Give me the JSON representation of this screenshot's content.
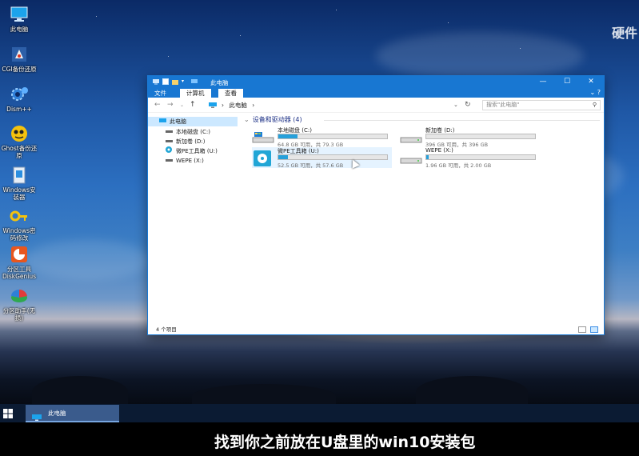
{
  "desktop": {
    "watermark": "硬件",
    "icons": [
      {
        "label": "此电脑",
        "icon": "computer-icon"
      },
      {
        "label": "CGI备份还原",
        "icon": "cgi-backup-icon"
      },
      {
        "label": "Dism++",
        "icon": "dism-gear-icon"
      },
      {
        "label": "Ghost备份还原",
        "icon": "ghost-icon"
      },
      {
        "label": "Windows安装器",
        "icon": "windows-installer-icon"
      },
      {
        "label": "Windows密码修改",
        "icon": "key-icon"
      },
      {
        "label": "分区工具DiskGenius",
        "icon": "diskgenius-icon"
      },
      {
        "label": "分区助手(无损)",
        "icon": "partition-assistant-icon"
      }
    ]
  },
  "explorer": {
    "title": "此电脑",
    "ribbon": {
      "file": "文件",
      "computer": "计算机",
      "view": "查看"
    },
    "address": {
      "path": "此电脑",
      "separator": "›"
    },
    "search": {
      "placeholder": "搜索\"此电脑\""
    },
    "nav_pane": [
      {
        "label": "此电脑",
        "selected": true
      },
      {
        "label": "本地磁盘 (C:)"
      },
      {
        "label": "新加卷 (D:)"
      },
      {
        "label": "微PE工具箱 (U:)"
      },
      {
        "label": "WEPE (X:)"
      }
    ],
    "group_header": "设备和驱动器 (4)",
    "drives": [
      {
        "name": "本地磁盘 (C:)",
        "free": "64.8 GB 可用，共 79.3 GB",
        "used_fraction": 0.18
      },
      {
        "name": "新加卷 (D:)",
        "free": "396 GB 可用，共 396 GB",
        "used_fraction": 0.0
      },
      {
        "name": "微PE工具箱 (U:)",
        "free": "52.5 GB 可用，共 57.6 GB",
        "used_fraction": 0.09
      },
      {
        "name": "WEPE (X:)",
        "free": "1.96 GB 可用，共 2.00 GB",
        "used_fraction": 0.02
      }
    ],
    "status": "4 个项目"
  },
  "taskbar": {
    "item": "此电脑"
  },
  "subtitle": "找到你之前放在U盘里的win10安装包",
  "colors": {
    "accent": "#1877d2",
    "progress": "#26a0da",
    "selection": "#cce8ff"
  }
}
